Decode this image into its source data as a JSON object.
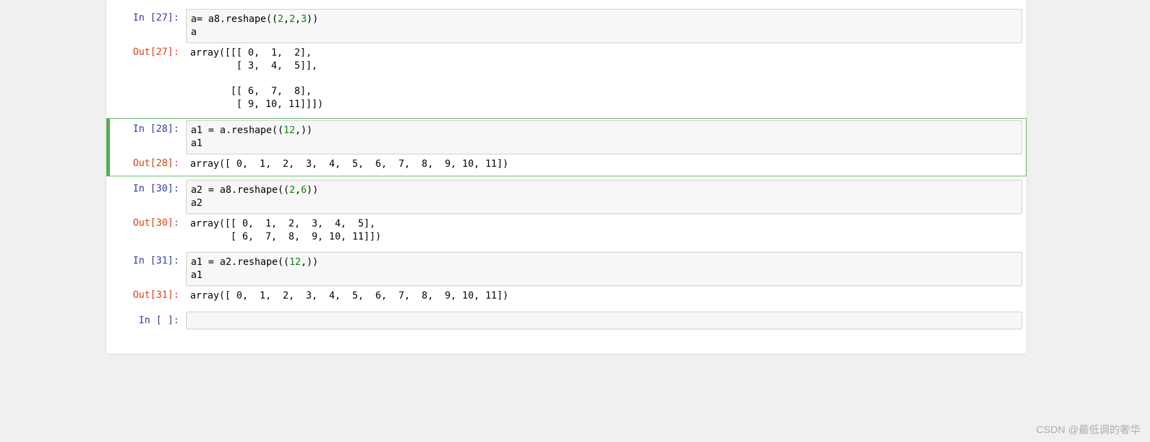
{
  "cells": [
    {
      "in_label": "In  [27]:",
      "out_label": "Out[27]:",
      "code_plain": "a= a8.reshape((2,2,3))\na",
      "code_tokens": [
        [
          {
            "t": "var",
            "v": "a"
          },
          {
            "t": "op",
            "v": "= "
          },
          {
            "t": "var",
            "v": "a8"
          },
          {
            "t": "op",
            "v": "."
          },
          {
            "t": "id",
            "v": "reshape"
          },
          {
            "t": "paren",
            "v": "(("
          },
          {
            "t": "num",
            "v": "2"
          },
          {
            "t": "op",
            "v": ","
          },
          {
            "t": "num",
            "v": "2"
          },
          {
            "t": "op",
            "v": ","
          },
          {
            "t": "num",
            "v": "3"
          },
          {
            "t": "paren",
            "v": "))"
          }
        ],
        [
          {
            "t": "var",
            "v": "a"
          }
        ]
      ],
      "output": "array([[[ 0,  1,  2],\n        [ 3,  4,  5]],\n\n       [[ 6,  7,  8],\n        [ 9, 10, 11]]])"
    },
    {
      "selected": true,
      "in_label": "In  [28]:",
      "out_label": "Out[28]:",
      "code_plain": "a1 = a.reshape((12,))\na1",
      "code_tokens": [
        [
          {
            "t": "var",
            "v": "a1"
          },
          {
            "t": "op",
            "v": " = "
          },
          {
            "t": "var",
            "v": "a"
          },
          {
            "t": "op",
            "v": "."
          },
          {
            "t": "id",
            "v": "reshape"
          },
          {
            "t": "paren",
            "v": "(("
          },
          {
            "t": "num",
            "v": "12"
          },
          {
            "t": "op",
            "v": ","
          },
          {
            "t": "paren",
            "v": "))"
          }
        ],
        [
          {
            "t": "var",
            "v": "a1"
          }
        ]
      ],
      "output": "array([ 0,  1,  2,  3,  4,  5,  6,  7,  8,  9, 10, 11])"
    },
    {
      "in_label": "In  [30]:",
      "out_label": "Out[30]:",
      "code_plain": "a2 = a8.reshape((2,6))\na2",
      "code_tokens": [
        [
          {
            "t": "var",
            "v": "a2"
          },
          {
            "t": "op",
            "v": " = "
          },
          {
            "t": "var",
            "v": "a8"
          },
          {
            "t": "op",
            "v": "."
          },
          {
            "t": "id",
            "v": "reshape"
          },
          {
            "t": "paren",
            "v": "(("
          },
          {
            "t": "num",
            "v": "2"
          },
          {
            "t": "op",
            "v": ","
          },
          {
            "t": "num",
            "v": "6"
          },
          {
            "t": "paren",
            "v": "))"
          }
        ],
        [
          {
            "t": "var",
            "v": "a2"
          }
        ]
      ],
      "output": "array([[ 0,  1,  2,  3,  4,  5],\n       [ 6,  7,  8,  9, 10, 11]])"
    },
    {
      "in_label": "In  [31]:",
      "out_label": "Out[31]:",
      "code_plain": "a1 = a2.reshape((12,))\na1",
      "code_tokens": [
        [
          {
            "t": "var",
            "v": "a1"
          },
          {
            "t": "op",
            "v": " = "
          },
          {
            "t": "var",
            "v": "a2"
          },
          {
            "t": "op",
            "v": "."
          },
          {
            "t": "id",
            "v": "reshape"
          },
          {
            "t": "paren",
            "v": "(("
          },
          {
            "t": "num",
            "v": "12"
          },
          {
            "t": "op",
            "v": ","
          },
          {
            "t": "paren",
            "v": "))"
          }
        ],
        [
          {
            "t": "var",
            "v": "a1"
          }
        ]
      ],
      "output": "array([ 0,  1,  2,  3,  4,  5,  6,  7,  8,  9, 10, 11])"
    },
    {
      "in_label": "In  [  ]:",
      "empty": true
    }
  ],
  "watermark": "CSDN @最低调的奢华"
}
